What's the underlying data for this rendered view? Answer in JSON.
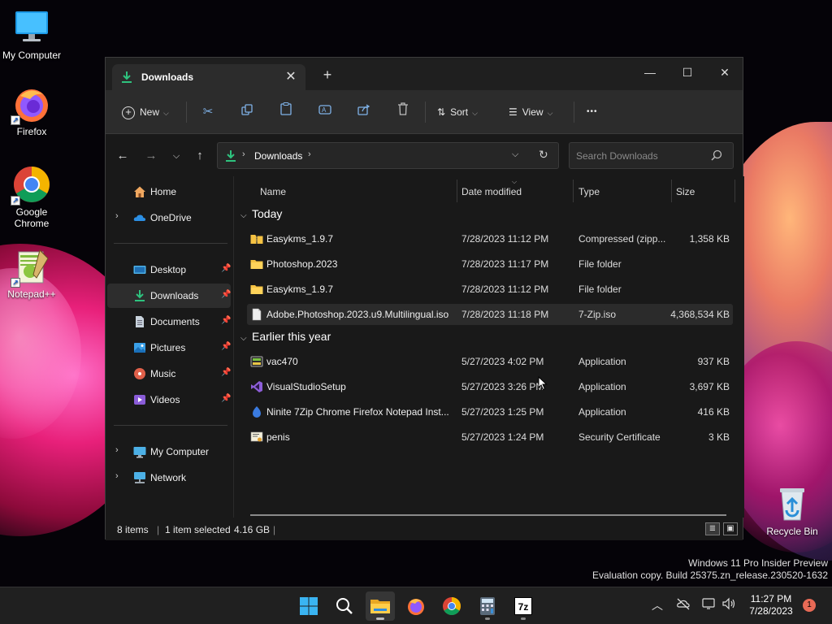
{
  "desktop": {
    "icons": [
      {
        "label": "My Computer"
      },
      {
        "label": "Firefox"
      },
      {
        "label": "Google Chrome"
      },
      {
        "label": "Notepad++"
      },
      {
        "label": "Recycle Bin"
      }
    ],
    "watermark": {
      "line1": "Windows 11 Pro Insider Preview",
      "line2": "Evaluation copy. Build 25375.zn_release.230520-1632"
    }
  },
  "window": {
    "tab_title": "Downloads",
    "tab_close": "✕",
    "new_tab": "+",
    "controls": {
      "minimize": "—",
      "maximize": "☐",
      "close": "✕"
    },
    "toolbar": {
      "new_label": "New",
      "sort_label": "Sort",
      "view_label": "View",
      "more": "•••"
    },
    "address": {
      "crumb": "Downloads",
      "search_placeholder": "Search Downloads"
    },
    "sidebar": {
      "items": [
        {
          "label": "Home"
        },
        {
          "label": "OneDrive"
        },
        {
          "label": "Desktop"
        },
        {
          "label": "Downloads"
        },
        {
          "label": "Documents"
        },
        {
          "label": "Pictures"
        },
        {
          "label": "Music"
        },
        {
          "label": "Videos"
        },
        {
          "label": "My Computer"
        },
        {
          "label": "Network"
        }
      ]
    },
    "columns": {
      "name": "Name",
      "date": "Date modified",
      "type": "Type",
      "size": "Size"
    },
    "groups": [
      {
        "title": "Today",
        "files": [
          {
            "name": "Easykms_1.9.7",
            "date": "7/28/2023 11:12 PM",
            "type": "Compressed (zipp...",
            "size": "1,358 KB",
            "icon": "zip-folder-icon"
          },
          {
            "name": "Photoshop.2023",
            "date": "7/28/2023 11:17 PM",
            "type": "File folder",
            "size": "",
            "icon": "folder-icon"
          },
          {
            "name": "Easykms_1.9.7",
            "date": "7/28/2023 11:12 PM",
            "type": "File folder",
            "size": "",
            "icon": "folder-icon"
          },
          {
            "name": "Adobe.Photoshop.2023.u9.Multilingual.iso",
            "date": "7/28/2023 11:18 PM",
            "type": "7-Zip.iso",
            "size": "4,368,534 KB",
            "icon": "file-icon"
          }
        ]
      },
      {
        "title": "Earlier this year",
        "files": [
          {
            "name": "vac470",
            "date": "5/27/2023 4:02 PM",
            "type": "Application",
            "size": "937 KB",
            "icon": "app-icon"
          },
          {
            "name": "VisualStudioSetup",
            "date": "5/27/2023 3:26 PM",
            "type": "Application",
            "size": "3,697 KB",
            "icon": "visual-studio-icon"
          },
          {
            "name": "Ninite 7Zip Chrome Firefox Notepad Inst...",
            "date": "5/27/2023 1:25 PM",
            "type": "Application",
            "size": "416 KB",
            "icon": "ninite-icon"
          },
          {
            "name": "penis",
            "date": "5/27/2023 1:24 PM",
            "type": "Security Certificate",
            "size": "3 KB",
            "icon": "certificate-icon"
          }
        ]
      }
    ],
    "status": {
      "items": "8 items",
      "selected": "1 item selected",
      "size": "4.16 GB"
    }
  },
  "taskbar": {
    "time": "11:27 PM",
    "date": "7/28/2023",
    "notification_count": "1",
    "sevenzip_label": "7z"
  },
  "colors": {
    "accent": "#4cc2ff",
    "folder": "#f5c243",
    "download_green": "#2ec27e"
  }
}
